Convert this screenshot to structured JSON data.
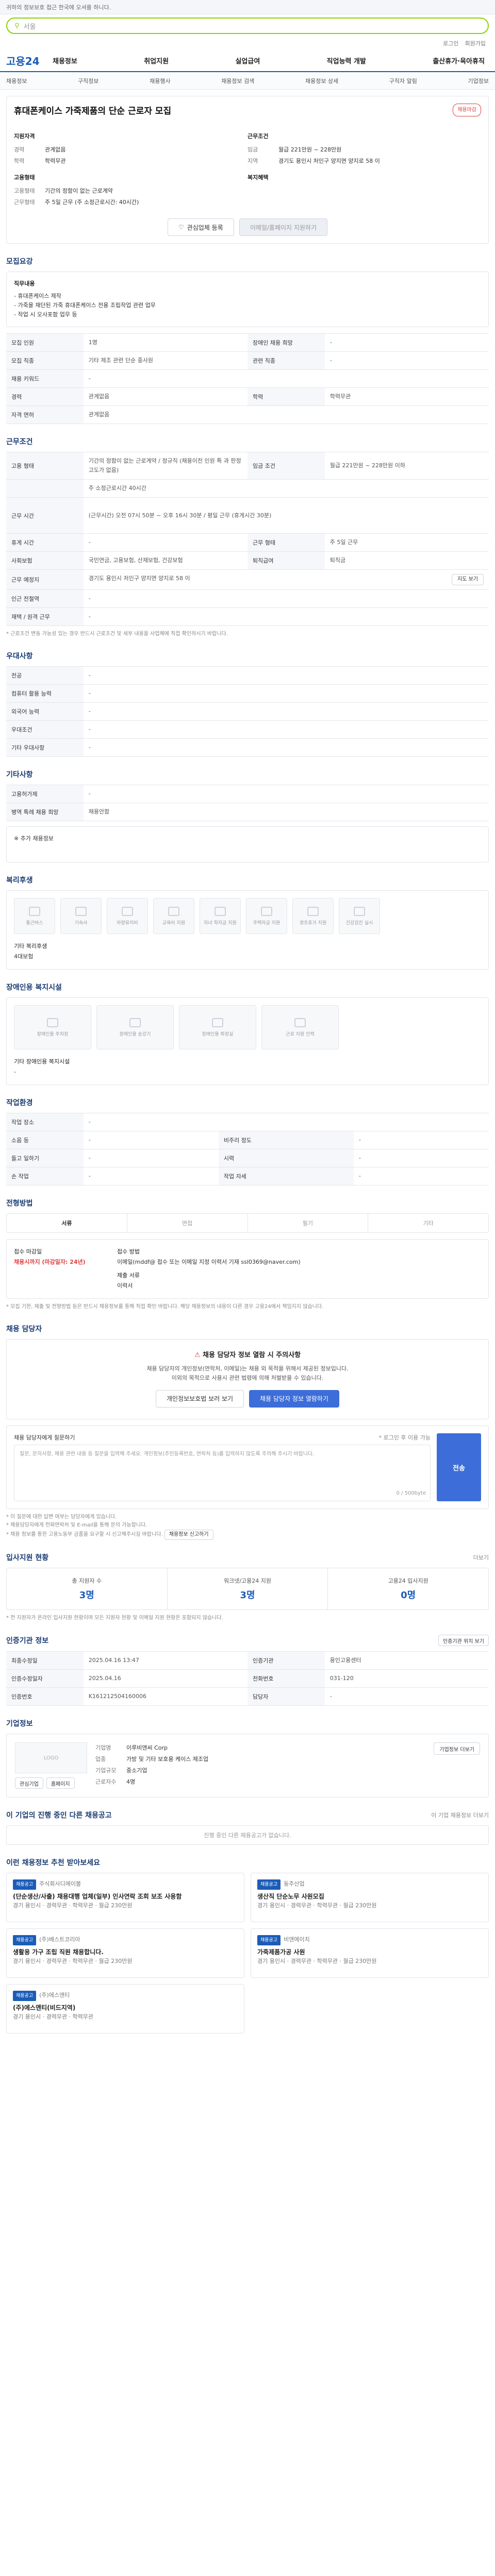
{
  "top": {
    "notice": "귀하의 정보보호 접근 한국에 오셔를 하니다.",
    "search_value": "서울",
    "search_right": "통합검색"
  },
  "util": [
    "로그인",
    "회원가입"
  ],
  "gnb": {
    "logo": "고용24",
    "menu": [
      "채용정보",
      "취업지원",
      "실업급여",
      "직업능력 개발",
      "출산휴가·육아휴직"
    ]
  },
  "lnb": [
    "채용정보",
    "구직정보",
    "채용행사",
    "채용정보 검색",
    "채용정보 상세",
    "구직자 알림",
    "기업정보"
  ],
  "header": {
    "title": "휴대폰케이스 가죽제품의 단순 근로자 모집",
    "badge": "채용마감",
    "left_title": "지원자격",
    "left": [
      {
        "k": "경력",
        "v": "관계없음"
      },
      {
        "k": "학력",
        "v": "학력무관"
      }
    ],
    "left_title2": "고용형태",
    "left2": [
      {
        "k": "고용형태",
        "v": "기간의 정함이 없는 근로계약"
      },
      {
        "k": "근무형태",
        "v": "주 5일 근무 (주 소정근로시간: 40시간)"
      }
    ],
    "right_title": "근무조건",
    "right": [
      {
        "k": "임금",
        "v": "월급 221만원 ~ 228만원"
      },
      {
        "k": "지역",
        "v": "경기도 용인시 처인구 양지면 양지로 58 이"
      }
    ],
    "right_title2": "복지혜택",
    "btn_fav": "관심업체 등록",
    "btn_apply": "이메일/홈페이지 지원하기"
  },
  "recruit": {
    "title": "모집요강",
    "duty_title": "직무내용",
    "duty": [
      "- 휴대폰케이스 제작",
      "- 가죽을 재단된 가죽 휴대폰케이스 전용 조립작업 관련 업무",
      "- 작업 시 오사포함 업무 등"
    ],
    "rows": [
      {
        "k1": "모집 인원",
        "v1": "1명",
        "k2": "장애인 채용 희망",
        "v2": "-"
      },
      {
        "k1": "모집 직종",
        "v1": "기타 제조 관련 단순 종사원",
        "k2": "관련 직종",
        "v2": "-"
      },
      {
        "k1": "채용 키워드",
        "v1": "-",
        "k2": "",
        "": "",
        "v2": ""
      },
      {
        "k1": "경력",
        "v1": "관계없음",
        "k2": "학력",
        "v2": "학력무관"
      },
      {
        "k1": "자격 면허",
        "v1": "관계없음",
        "k2": "",
        "v2": ""
      }
    ]
  },
  "condition": {
    "title": "근무조건",
    "rows": [
      {
        "k1": "고용 형태",
        "v1": "기간의 정함이 없는 근로계약 / 정규직 (채용이전 인원 특 과 판정 고도가 없음)",
        "k2": "임금 조건",
        "v2": "월급 221만원 ~ 228만원 이하"
      },
      {
        "k1": "",
        "v1": "주 소정근로시간 40시간",
        "k2": "",
        "v2": ""
      },
      {
        "k1": "근무 시간",
        "v1": "(근무시간) 오전 07시 50분 ~ 오후 16시 30분 / 평일 근무 (휴게시간 30분)",
        "k2": "",
        "v2": ""
      },
      {
        "k1": "휴게 시간",
        "v1": "-",
        "k2": "근무 형태",
        "v2": "주 5일 근무"
      },
      {
        "k1": "사회보험",
        "v1": "국민연금, 고용보험, 산재보험, 건강보험",
        "k2": "퇴직급여",
        "v2": "퇴직금"
      },
      {
        "k1": "근무 예정지",
        "v1": "경기도 용인시 처인구 양지면 양지로 58 이",
        "k2": "",
        "v2": ""
      },
      {
        "k1": "인근 전철역",
        "v1": "-",
        "k2": "",
        "v2": ""
      },
      {
        "k1": "재택 / 원격 근무",
        "v1": "-",
        "k2": "",
        "v2": ""
      }
    ],
    "note": "* 근로조건 변동 가능성 있는 경우 반드시 근로조건 및 세부 내용을 사업체에 직접 확인하시기 바랍니다.",
    "map_btn": "지도 보기"
  },
  "preference": {
    "title": "우대사항",
    "rows": [
      {
        "k": "전공",
        "v": "-"
      },
      {
        "k": "컴퓨터 활용 능력",
        "v": "-"
      },
      {
        "k": "외국어 능력",
        "v": "-"
      },
      {
        "k": "우대조건",
        "v": "-"
      },
      {
        "k": "기타 우대사항",
        "v": "-"
      }
    ]
  },
  "other": {
    "title": "기타사항",
    "rows": [
      {
        "k": "고용허가제",
        "v": "-"
      },
      {
        "k": "병역 특례 채용 희망",
        "v": "채용안함"
      }
    ],
    "extra": "※ 추가 채용정보"
  },
  "welfare": {
    "title": "복리후생",
    "items": [
      "통근버스",
      "기숙사",
      "차량유지비",
      "교육비 지원",
      "자녀 학자금 지원",
      "주택자금 지원",
      "경조휴가 지원",
      "건강검진 실시"
    ],
    "extra_label": "기타 복리후생",
    "extra_value": "4대보험"
  },
  "disability": {
    "title": "장애인용 복지시설",
    "items": [
      "장애인용 주차장",
      "장애인용 승강기",
      "장애인용 화장실",
      "근로 지원 인력"
    ],
    "extra_label": "기타 장애인용 복지시설",
    "extra_value": "-"
  },
  "env": {
    "title": "작업환경",
    "rows": [
      {
        "k1": "작업 장소",
        "v1": "-",
        "k2": "",
        "v2": ""
      },
      {
        "k1": "소음 등",
        "v1": "-",
        "k2": "비주리 정도",
        "v2": "-"
      },
      {
        "k1": "들고 일하기",
        "v1": "-",
        "k2": "시력",
        "v2": "-"
      },
      {
        "k1": "손 작업",
        "v1": "-",
        "k2": "작업 자세",
        "v2": "-"
      }
    ]
  },
  "process": {
    "title": "전형방법",
    "tabs": [
      "서류",
      "면접",
      "필기",
      "기타"
    ],
    "left_title": "접수 마감일",
    "left_value": "채용시까지 (마감일자: 24년)",
    "right_title": "접수 방법",
    "right_value": "이메일(mddf@ 접수 또는 이메일 지정 이력서 기재 ssl0369@naver.com)",
    "doc_label": "제출 서류",
    "doc_value": "이력서",
    "note": "* 모집 기한, 제출 및 전형방법 등은 반드시 채용정보를 통해 직접 확인 바랍니다. 해당 채용정보의 내용이 다른 경우 고용24에서 책임지지 않습니다."
  },
  "manager": {
    "title": "채용 담당자",
    "warn_title": "채용 담당자 정보 열람 시 주의사항",
    "warn_l1": "채용 담당자의 개인정보(연락처, 이메일)는 채용 외 목적을 위해서 제공된 정보입니다.",
    "warn_l2": "이외의 목적으로 사용시 관련 법령에 의해 처벌받을 수 있습니다.",
    "btn1": "개인정보보호법 보러 보기",
    "btn2": "채용 담당자 정보 열람하기",
    "msg_title": "채용 담당자에게 질문하기",
    "msg_hint": "* 로그인 후 이용 가능",
    "msg_placeholder": "질문, 문의사항, 채용 관련 내용 등 질문을 입력해 주세요. 개인정보(주민등록번호, 연락처 등)를 입력하지 않도록 주의해 주시기 바랍니다.",
    "msg_count": "0 / 500byte",
    "send": "전송",
    "notes": [
      "* 이 질문에 대한 답변 여부는 담당자에게 있습니다.",
      "* 채용담당자에게 전화연락처 및 E-mail을 통해 문의 가능합니다.",
      "* 채용 정보를 통한 고용노동부 금품을 요구할 시 신고해주시길 바랍니다."
    ],
    "report": "채용정보 신고하기"
  },
  "applicants": {
    "title": "입사지원 현황",
    "more": "더보기",
    "stats": [
      {
        "label": "총 지원자 수",
        "value": "3명"
      },
      {
        "label": "워크넷/고용24 지원",
        "value": "3명"
      },
      {
        "label": "고용24 입사지원",
        "value": "0명"
      }
    ],
    "note": "* 전 지원자가 온라인 입사지원 현황이며 모든 지원자 현황 및 이메일 지원 현황은 포함되지 않습니다."
  },
  "agency": {
    "title": "인증기관 정보",
    "btn": "인증기관 위치 보기",
    "rows": [
      {
        "k1": "최종수정일",
        "v1": "2025.04.16 13:47",
        "k2": "인증기관",
        "v2": "용인고용센터"
      },
      {
        "k1": "인증수정일자",
        "v1": "2025.04.16",
        "k2": "전화번호",
        "v2": "031-120"
      },
      {
        "k1": "인증번호",
        "v1": "K161212504160006",
        "k2": "담당자",
        "v2": "-"
      }
    ]
  },
  "company": {
    "title": "기업정보",
    "logo": "LOGO",
    "rows": [
      {
        "k": "기업명",
        "v": "이루비앤씨 Corp"
      },
      {
        "k": "업종",
        "v": "가방 및 기타 보호용 케이스 제조업"
      },
      {
        "k": "기업규모",
        "v": "중소기업"
      },
      {
        "k": "근로자수",
        "v": "4명"
      }
    ],
    "btn": "기업정보 더보기",
    "links": [
      "관심기업",
      "홈페이지"
    ]
  },
  "others": {
    "title": "이 기업의 진행 중인 다른 채용공고",
    "empty": "진행 중인 다른 채용공고가 없습니다.",
    "more": "이 기업 채용정보 더보기"
  },
  "reco": {
    "title": "이런 채용정보 추천 받아보세요",
    "cards": [
      {
        "tag": "채용공고",
        "co": "주식회사디에이블",
        "title": "(단순생산/사출) 채용대행 업체(일부) 인사연락 조회 보조 사용함",
        "meta": "경기 용인시 · 경력무관 · 학력무관 · 월급 230만원"
      },
      {
        "tag": "채용공고",
        "co": "동주산업",
        "title": "생산직 단순노무 사원모집",
        "meta": "경기 용인시 · 경력무관 · 학력무관 · 월급 230만원"
      },
      {
        "tag": "채용공고",
        "co": "(주)베스트코리아",
        "title": "생활용 가구 조립 직원 채용합니다.",
        "meta": "경기 용인시 · 경력무관 · 학력무관 · 월급 230만원"
      },
      {
        "tag": "채용공고",
        "co": "비앤에이치",
        "title": "가죽제품가공 사원",
        "meta": "경기 용인시 · 경력무관 · 학력무관 · 월급 230만원"
      },
      {
        "tag": "채용공고",
        "co": "(주)에스앤티",
        "title": "(주)에스앤티(비드지역)",
        "meta": "경기 용인시 · 경력무관 · 학력무관"
      }
    ]
  }
}
